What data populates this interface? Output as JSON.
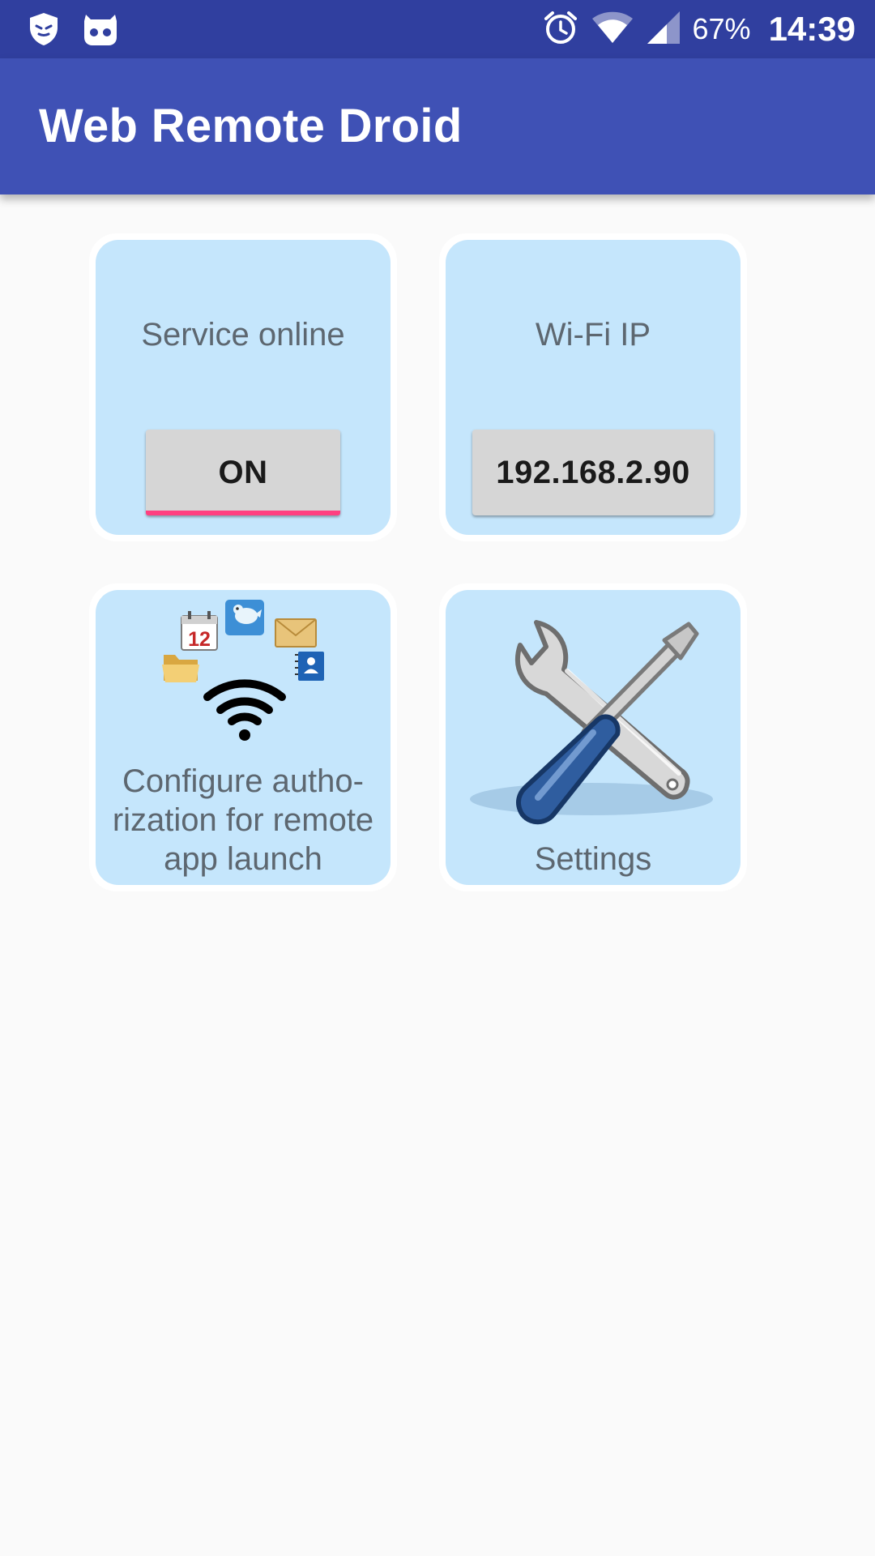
{
  "status_bar": {
    "battery": "67%",
    "time": "14:39",
    "icons": [
      "shield-icon",
      "cyanogen-icon",
      "alarm-icon",
      "wifi-signal-icon",
      "cell-signal-icon"
    ]
  },
  "app_bar": {
    "title": "Web Remote Droid"
  },
  "tiles": {
    "service": {
      "label": "Service online",
      "button": "ON",
      "accent": "#ff4081"
    },
    "wifi": {
      "label": "Wi-Fi IP",
      "button": "192.168.2.90"
    },
    "authorization": {
      "label_lines": [
        "Configure autho-",
        "rization for remote",
        "app launch"
      ],
      "calendar_day": "12",
      "icons": [
        "calendar-icon",
        "bird-icon",
        "mail-icon",
        "folder-icon",
        "contacts-icon",
        "wifi-icon"
      ]
    },
    "settings": {
      "label": "Settings",
      "icons": [
        "wrench-screwdriver-icon"
      ]
    }
  },
  "colors": {
    "status_bar": "#303f9f",
    "app_bar": "#3f51b5",
    "tile_bg": "#c5e6fc",
    "background": "#fafafa"
  }
}
